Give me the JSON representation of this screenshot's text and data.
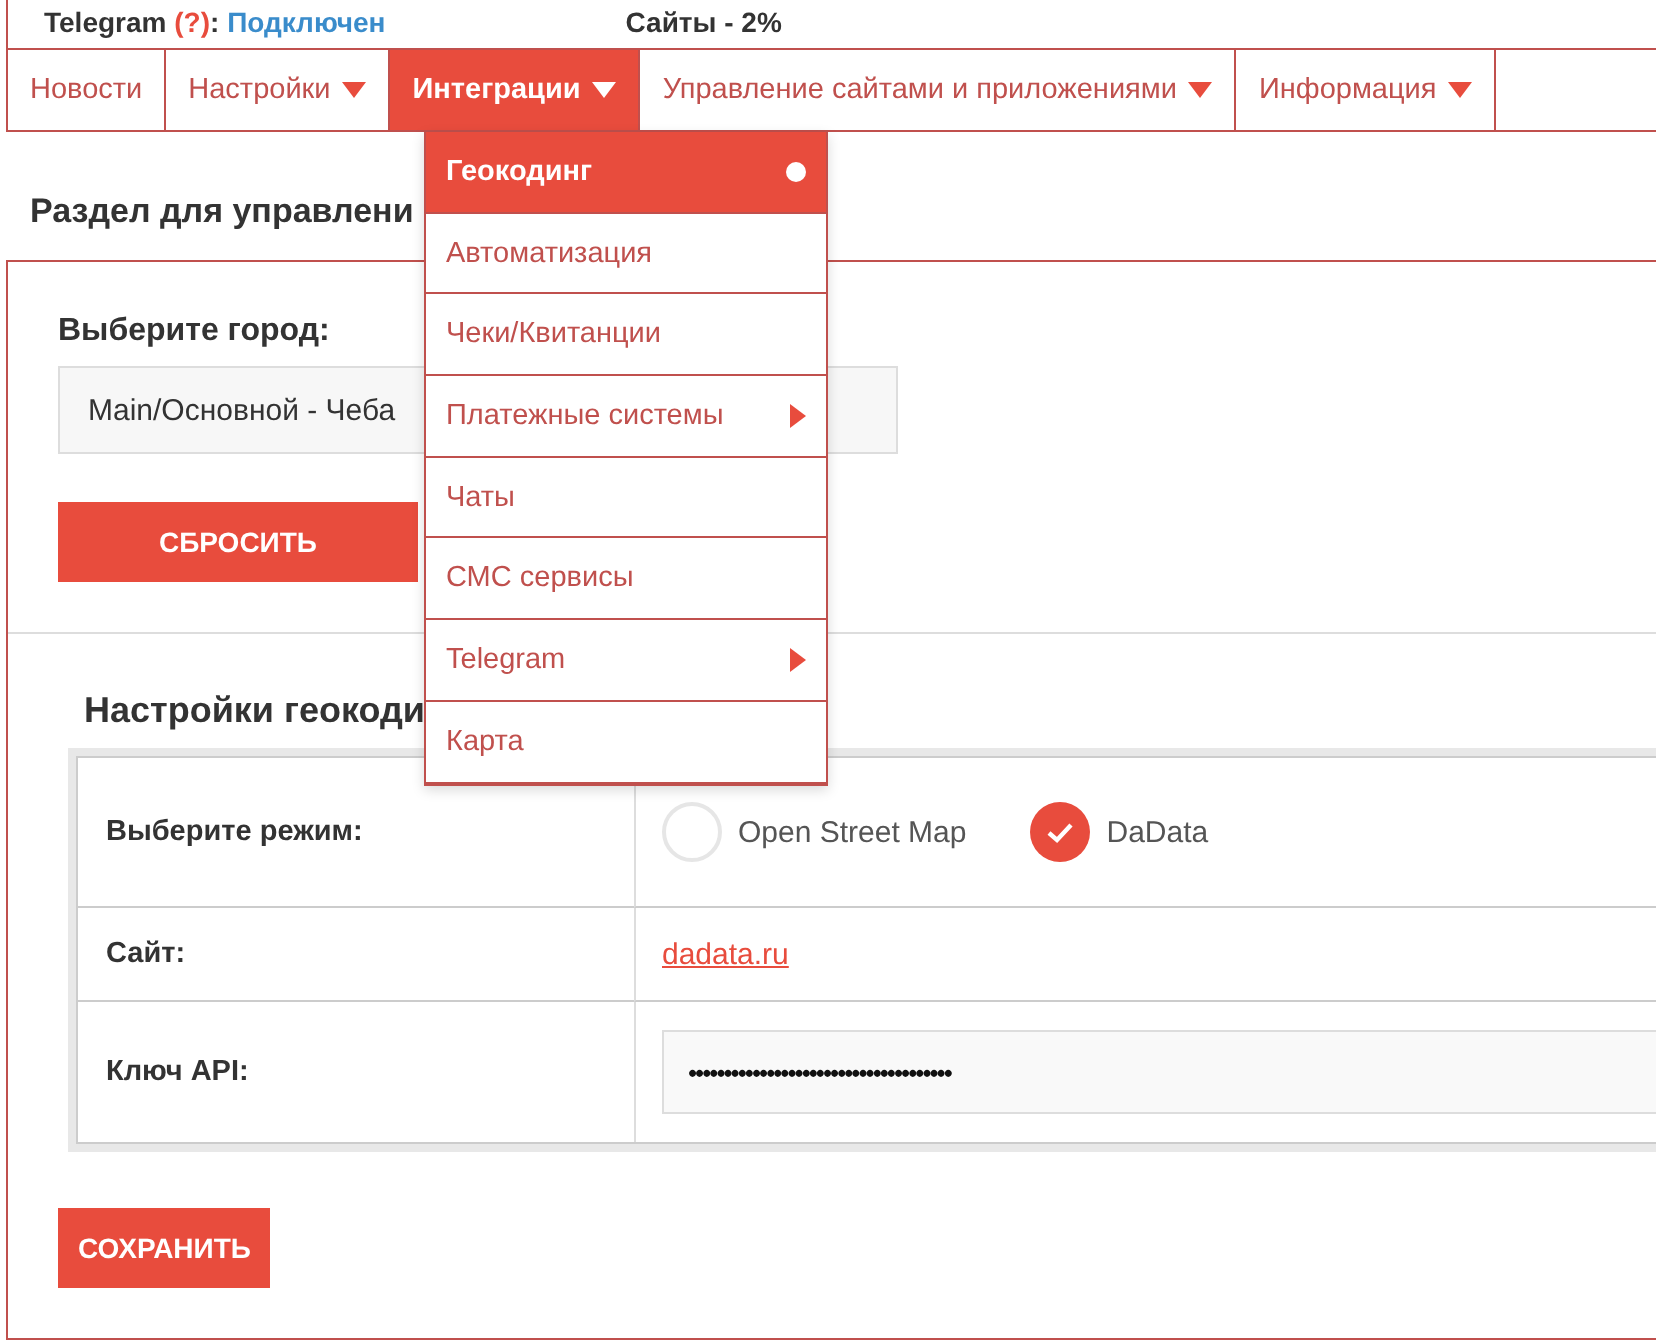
{
  "status": {
    "telegram_label": "Telegram",
    "telegram_hint": "(?)",
    "telegram_sep": ":",
    "telegram_value": "Подключен",
    "sites": "Сайты - 2%"
  },
  "nav": [
    {
      "label": "Новости",
      "selected": false,
      "caret": false
    },
    {
      "label": "Настройки",
      "selected": false,
      "caret": true
    },
    {
      "label": "Интеграции",
      "selected": true,
      "caret": true
    },
    {
      "label": "Управление сайтами и приложениями",
      "selected": false,
      "caret": true
    },
    {
      "label": "Информация",
      "selected": false,
      "caret": true
    }
  ],
  "menu": [
    {
      "label": "Геокодинг",
      "selected": true,
      "submenu": false
    },
    {
      "label": "Автоматизация",
      "selected": false,
      "submenu": false
    },
    {
      "label": "Чеки/Квитанции",
      "selected": false,
      "submenu": false
    },
    {
      "label": "Платежные системы",
      "selected": false,
      "submenu": true
    },
    {
      "label": "Чаты",
      "selected": false,
      "submenu": false
    },
    {
      "label": "СМС сервисы",
      "selected": false,
      "submenu": false
    },
    {
      "label": "Telegram",
      "selected": false,
      "submenu": true
    },
    {
      "label": "Карта",
      "selected": false,
      "submenu": false
    }
  ],
  "section_title": "Раздел для управлени",
  "city": {
    "label": "Выберите город:",
    "value": "Main/Основной - Чеба",
    "reset": "СБРОСИТЬ"
  },
  "geocoding": {
    "title": "Настройки геокоди",
    "mode_label": "Выберите режим:",
    "modes": [
      {
        "label": "Open Street Map",
        "selected": false
      },
      {
        "label": "DaData",
        "selected": true
      }
    ],
    "site_label": "Сайт:",
    "site_link": "dadata.ru",
    "key_label": "Ключ API:",
    "key_value": "•••••••••••••••••••••••••••••••••••••"
  },
  "save": "СОХРАНИТЬ"
}
